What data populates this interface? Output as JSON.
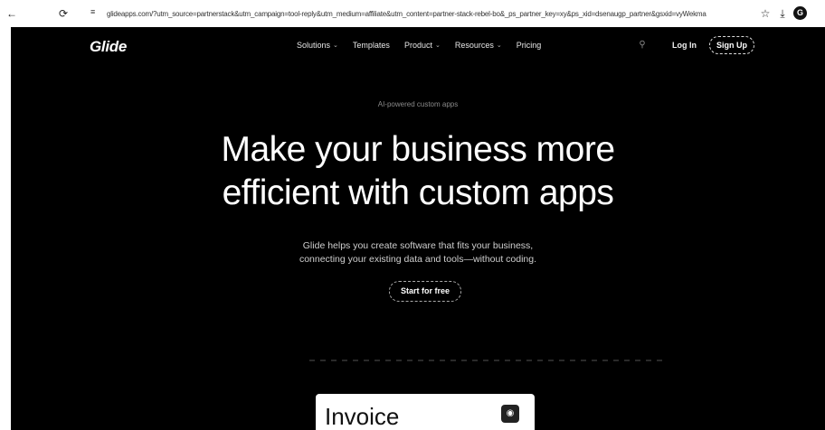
{
  "browser": {
    "back_icon": "arrow-left-icon",
    "reload_icon": "reload-icon",
    "url": "glideapps.com/?utm_source=partnerstack&utm_campaign=tool-reply&utm_medium=affiliate&utm_content=partner-stack-rebel-bo&_ps_partner_key=xy&ps_xid=dsenaugp_partner&gsxid=vyWekma",
    "profile_initial": "G"
  },
  "header": {
    "logo": "Glide",
    "nav": [
      {
        "label": "Solutions",
        "has_dropdown": true
      },
      {
        "label": "Templates",
        "has_dropdown": false
      },
      {
        "label": "Product",
        "has_dropdown": true
      },
      {
        "label": "Resources",
        "has_dropdown": true
      },
      {
        "label": "Pricing",
        "has_dropdown": false
      }
    ],
    "login": "Log In",
    "signup": "Sign Up"
  },
  "hero": {
    "tagline": "AI-powered custom apps",
    "title_line1": "Make your business more",
    "title_line2": "efficient with custom apps",
    "subtitle_line1": "Glide helps you create software that fits your business,",
    "subtitle_line2": "connecting your existing data and tools—without coding.",
    "cta": "Start for free"
  },
  "preview": {
    "card_title": "Invoice"
  },
  "colors": {
    "page_bg": "#000000",
    "text": "#ffffff"
  }
}
